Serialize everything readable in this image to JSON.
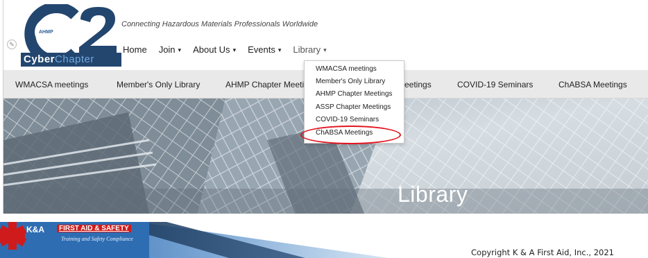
{
  "logo": {
    "org_badge": "AHMP",
    "mark": "C2",
    "cyber_word_1": "Cyber",
    "cyber_word_2": "Chapter"
  },
  "header": {
    "tagline": "Connecting Hazardous Materials Professionals Worldwide",
    "nav": [
      {
        "label": "Home",
        "has_caret": false
      },
      {
        "label": "Join",
        "has_caret": true
      },
      {
        "label": "About Us",
        "has_caret": true
      },
      {
        "label": "Events",
        "has_caret": true
      },
      {
        "label": "Library",
        "has_caret": true
      }
    ],
    "caret": "▾"
  },
  "subnav": {
    "items": [
      "WMACSA meetings",
      "Member's Only Library",
      "AHMP Chapter Meeti",
      "eetings",
      "COVID-19 Seminars",
      "ChABSA Meetings"
    ]
  },
  "library_dropdown": {
    "items": [
      "WMACSA meetings",
      "Member's Only Library",
      "AHMP Chapter Meetings",
      "ASSP Chapter Meetings",
      "COVID-19 Seminars",
      "ChABSA Meetings"
    ],
    "highlighted": "ChABSA Meetings"
  },
  "hero": {
    "title": "Library"
  },
  "footer": {
    "company_short": "K&A",
    "company_tag": "FIRST AID & SAFETY",
    "company_sub": "Training and Safety Compliance",
    "copyright": "Copyright K & A First Aid, Inc., 2021"
  },
  "colors": {
    "logo_navy": "#23466f",
    "logo_blue": "#6fa7dd",
    "subnav_bg": "#e9e9e9",
    "highlight_ring": "#e2141e",
    "ka_red": "#cf1b1b",
    "slide_banner_blue": "#2f6db3"
  }
}
